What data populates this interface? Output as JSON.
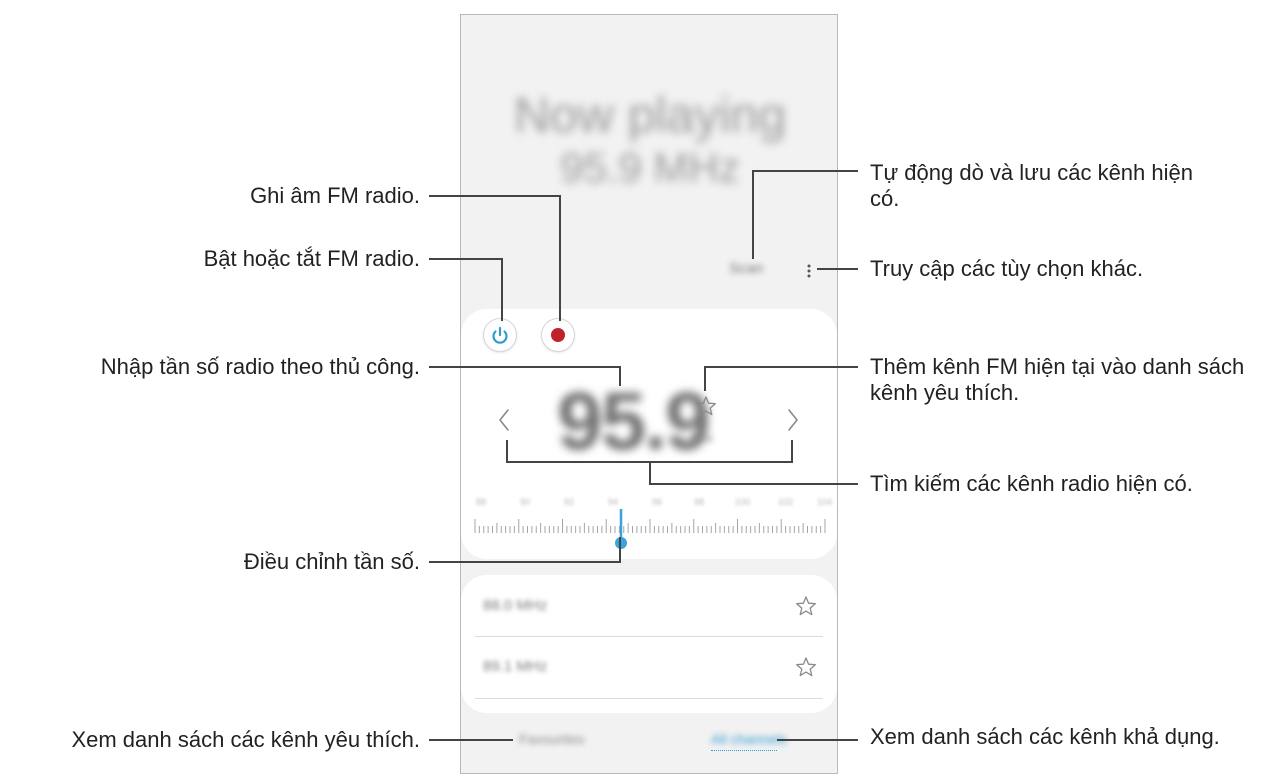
{
  "phone": {
    "now_playing_line1": "Now playing",
    "now_playing_line2": "95.9 MHz",
    "scan_label": "Scan",
    "more_icon": "more-vertical-icon",
    "power_icon": "power-icon",
    "record_icon": "record-icon",
    "frequency": "95.9",
    "frequency_unit": "MHz",
    "favorite_icon": "star-outline-icon",
    "prev_icon": "chevron-left-icon",
    "next_icon": "chevron-right-icon",
    "dial_labels": [
      "88",
      "90",
      "92",
      "94",
      "96",
      "98",
      "100",
      "102",
      "104"
    ],
    "channels": [
      {
        "freq": "88.0 MHz"
      },
      {
        "freq": "89.1 MHz"
      }
    ],
    "tab_favorites": "Favourites",
    "tab_all": "All channels",
    "colors": {
      "accent": "#2f9bd1",
      "record": "#c0212b",
      "dial_pointer": "#39a3db"
    }
  },
  "callouts": {
    "record": "Ghi âm FM radio.",
    "power": "Bật hoặc tắt FM radio.",
    "manual": "Nhập tần số radio theo thủ công.",
    "tune": "Điều chỉnh tần số.",
    "favorites_list": "Xem danh sách các kênh yêu thích.",
    "scan": "Tự động dò và lưu các kênh hiện có.",
    "more": "Truy cập các tùy chọn khác.",
    "add_favorite": "Thêm kênh FM hiện tại vào danh sách kênh yêu thích.",
    "search": "Tìm kiếm các kênh radio hiện có.",
    "all_list": "Xem danh sách các kênh khả dụng."
  }
}
